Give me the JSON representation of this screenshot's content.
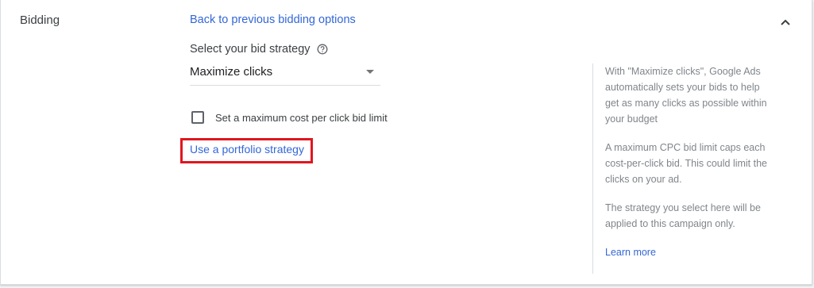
{
  "section": {
    "title": "Bidding",
    "back_link": "Back to previous bidding options"
  },
  "bid_strategy": {
    "label": "Select your bid strategy",
    "selected_value": "Maximize clicks"
  },
  "max_cpc": {
    "label": "Set a maximum cost per click bid limit",
    "checked": false
  },
  "portfolio": {
    "link": "Use a portfolio strategy"
  },
  "side_help": {
    "paragraph1": "With \"Maximize clicks\", Google Ads automatically sets your bids to help get as many clicks as possible within your budget",
    "paragraph2": "A maximum CPC bid limit caps each cost-per-click bid. This could limit the clicks on your ad.",
    "paragraph3": "The strategy you select here will be applied to this campaign only.",
    "learn_more": "Learn more"
  },
  "colors": {
    "link": "#3367d6",
    "highlight": "#e0161f",
    "text": "#3c4043",
    "help_text": "#80868b"
  },
  "icons": {
    "collapse": "chevron-up-icon",
    "help": "help-circle-icon",
    "dropdown": "dropdown-arrow-icon"
  }
}
